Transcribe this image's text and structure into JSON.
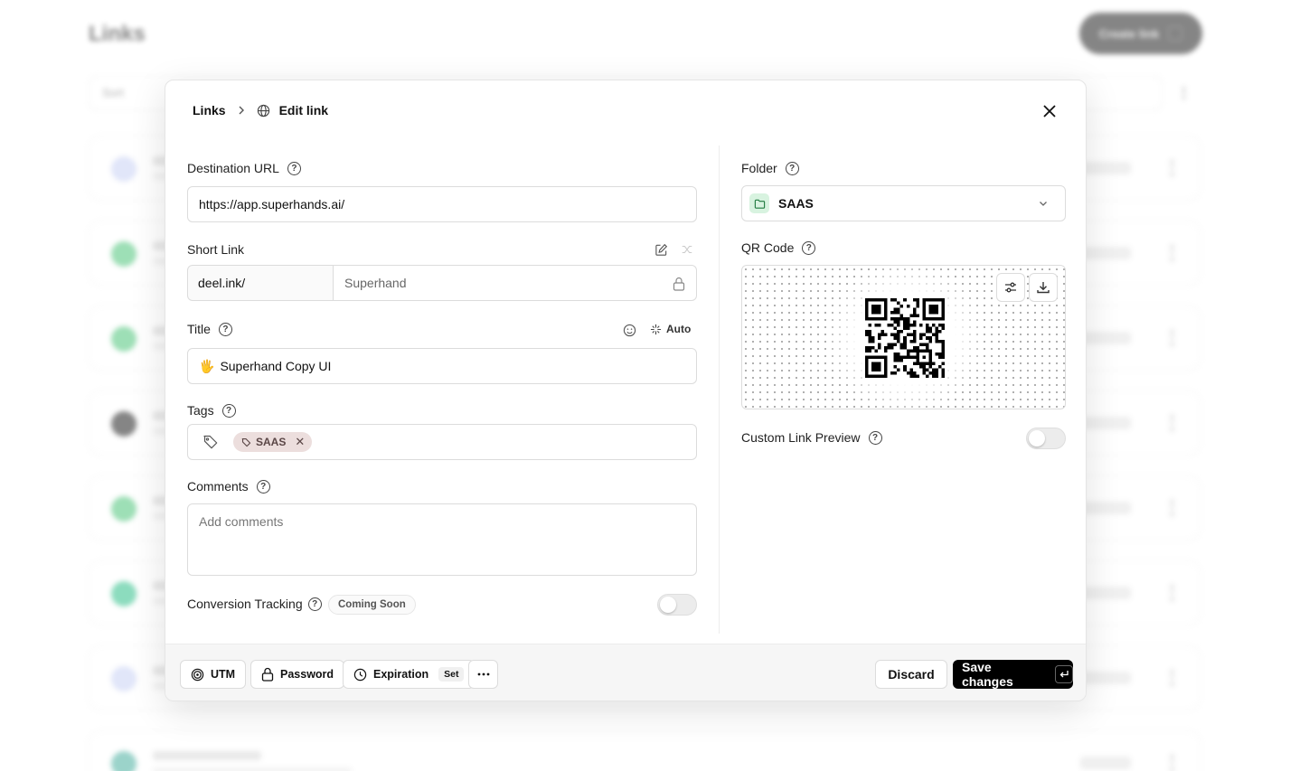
{
  "background": {
    "page_title": "Links",
    "create_label": "Create link",
    "filter_label": "Sort",
    "rows": [
      {
        "avatar_color": "#c9d2f5"
      },
      {
        "avatar_color": "#4ec57b"
      },
      {
        "avatar_color": "#4ec57b"
      },
      {
        "avatar_color": "#222222"
      },
      {
        "avatar_color": "#4ec57b"
      },
      {
        "avatar_color": "#2fc08a"
      },
      {
        "avatar_color": "#c9d2f5"
      },
      {
        "avatar_color": "#4ab0a0"
      }
    ]
  },
  "modal": {
    "breadcrumb": {
      "root": "Links",
      "current": "Edit link"
    },
    "destination": {
      "label": "Destination URL",
      "value": "https://app.superhands.ai/"
    },
    "short_link": {
      "label": "Short Link",
      "domain": "deel.ink/",
      "key_value": "Superhand"
    },
    "title": {
      "label": "Title",
      "emoji": "🖐",
      "value": "Superhand Copy UI",
      "auto_label": "Auto"
    },
    "tags": {
      "label": "Tags",
      "items": [
        "SAAS"
      ]
    },
    "comments": {
      "label": "Comments",
      "placeholder": "Add comments"
    },
    "conversion": {
      "label": "Conversion Tracking",
      "badge": "Coming Soon",
      "enabled": false
    },
    "folder": {
      "label": "Folder",
      "value": "SAAS"
    },
    "qr": {
      "label": "QR Code"
    },
    "custom_preview": {
      "label": "Custom Link Preview",
      "enabled": false
    },
    "footer": {
      "utm_label": "UTM",
      "password_label": "Password",
      "expiration_label": "Expiration",
      "expiration_badge": "Set",
      "discard_label": "Discard",
      "save_label": "Save changes"
    }
  },
  "colors": {
    "accent": "#000000",
    "tag_bg": "#ecdedd",
    "folder_icon_bg": "#d8f3e0"
  }
}
